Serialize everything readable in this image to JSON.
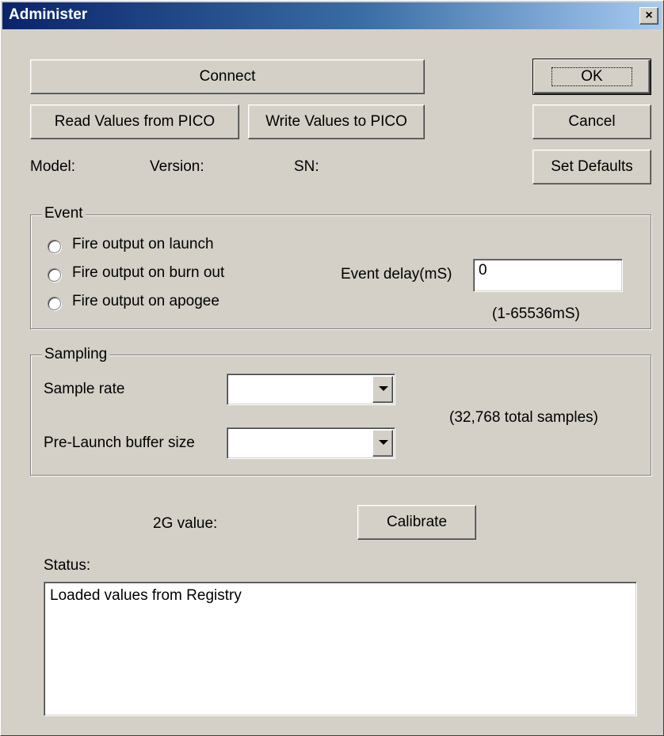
{
  "window": {
    "title": "Administer",
    "close_glyph": "×"
  },
  "buttons": {
    "connect": "Connect",
    "read_values": "Read Values from PICO",
    "write_values": "Write Values to PICO",
    "ok": "OK",
    "cancel": "Cancel",
    "set_defaults": "Set Defaults",
    "calibrate": "Calibrate"
  },
  "info": {
    "model_label": "Model:",
    "version_label": "Version:",
    "sn_label": "SN:"
  },
  "event": {
    "title": "Event",
    "options": [
      "Fire output on launch",
      "Fire output on burn out",
      "Fire output on apogee"
    ],
    "delay_label": "Event delay(mS)",
    "delay_value": "0",
    "delay_range": "(1-65536mS)"
  },
  "sampling": {
    "title": "Sampling",
    "sample_rate_label": "Sample rate",
    "sample_rate_value": "",
    "prelaunch_label": "Pre-Launch buffer size",
    "prelaunch_value": "",
    "total_samples": "(32,768 total samples)"
  },
  "calibration": {
    "label": "2G value:"
  },
  "status": {
    "label": "Status:",
    "text": "Loaded values from Registry"
  },
  "colors": {
    "face": "#d4d0c8",
    "title_start": "#0a246a",
    "title_end": "#a6caf0"
  },
  "icons": {
    "close": "close-icon",
    "dropdown": "chevron-down-icon",
    "radio": "radio-button"
  }
}
